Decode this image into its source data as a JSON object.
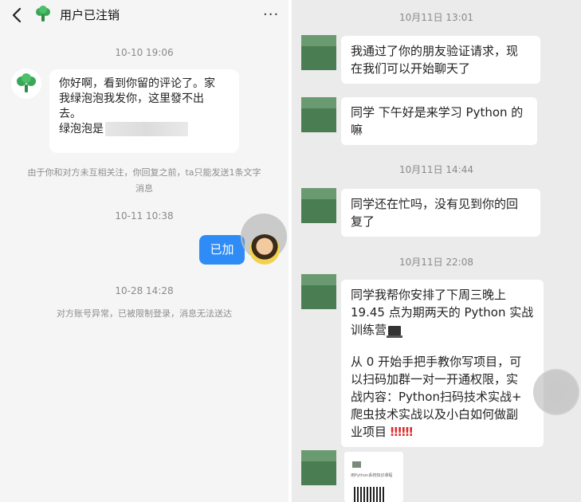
{
  "left": {
    "header": {
      "title": "用户已注销",
      "more_label": "···"
    },
    "time_1": "10-10 19:06",
    "incoming_message": {
      "line1": "你好啊，看到你留的评论了。家",
      "line2": "我绿泡泡我发你，这里發不出",
      "line3": "去。",
      "line4": "绿泡泡是"
    },
    "notice_follow_line1": "由于你和对方未互相关注，你回复之前，ta只能发送1条文字",
    "notice_follow_line2": "消息",
    "time_2": "10-11 10:38",
    "sent_message": "已加",
    "time_3": "10-28 14:28",
    "notice_account": "对方账号异常，已被限制登录，消息无法送达"
  },
  "right": {
    "time_1": "10月11日 13:01",
    "msg_1": {
      "line1": "我通过了你的朋友验证请求，现",
      "line2": "在我们可以开始聊天了"
    },
    "msg_2": {
      "line1": "同学 下午好是来学习 Python 的",
      "line2": "嘛"
    },
    "time_2": "10月11日 14:44",
    "msg_3": {
      "line1": "同学还在忙吗，没有见到你的回",
      "line2": "复了"
    },
    "time_3": "10月11日 22:08",
    "msg_4": {
      "line1": "同学我帮你安排了下周三晚上",
      "line2": "19.45 点为期两天的 Python 实战",
      "line3": "训练营",
      "line4": "从 0 开始手把手教你写项目，可",
      "line5": "以扫码加群一对一开通权限，实",
      "line6": "战内容：Python扫码技术实战+",
      "line7": "爬虫技术实战以及小白如何做副",
      "line8": "业项目",
      "line8_marks": "‼‼‼"
    },
    "image_caption": "用Python系统知识课程"
  },
  "colors": {
    "sent_bubble": "#2f8cf6",
    "wechat_avatar": "#4b7d52",
    "left_bg": "#f5f5f5",
    "right_bg": "#ebebeb"
  },
  "icons": [
    "back-arrow-icon",
    "broccoli-avatar-icon",
    "more-dots-icon",
    "laptop-emoji-icon"
  ]
}
